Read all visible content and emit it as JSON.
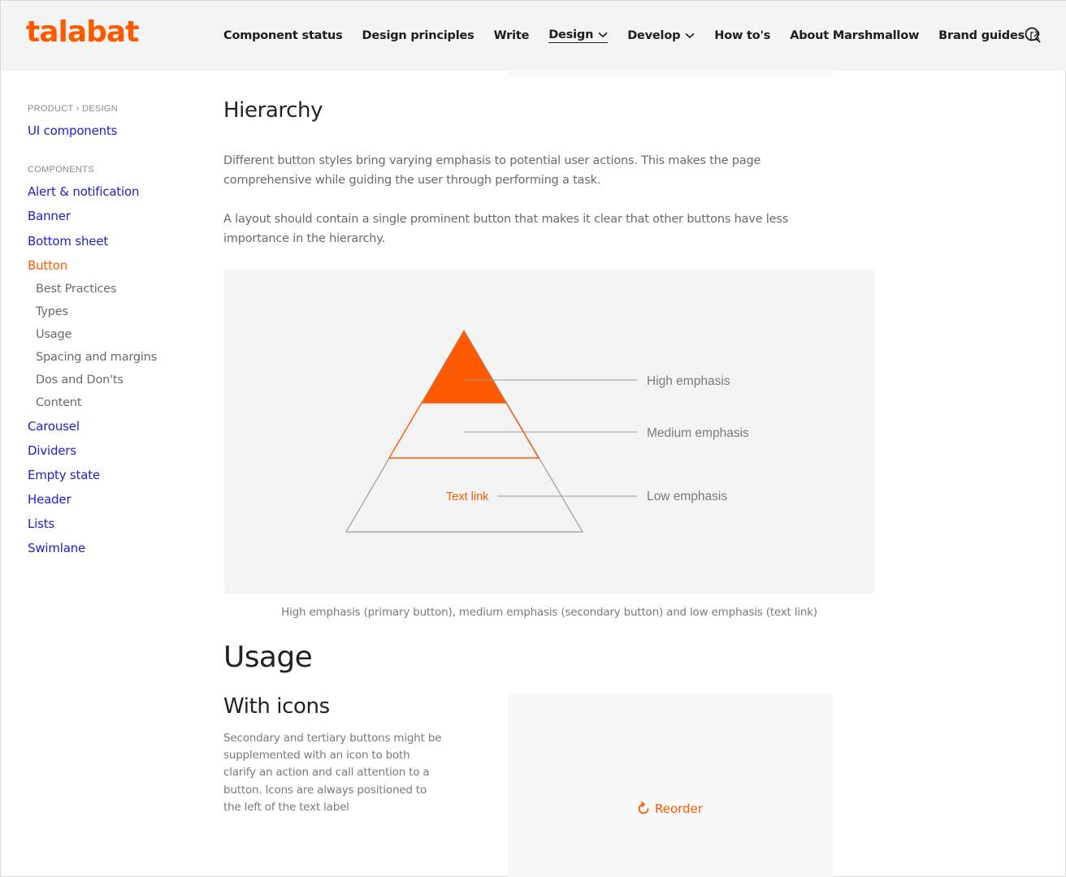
{
  "brand": {
    "logo": "talabat",
    "accent": "#ff5a00",
    "link": "#1f1fcc"
  },
  "nav": [
    {
      "label": "Component status"
    },
    {
      "label": "Design principles"
    },
    {
      "label": "Write"
    },
    {
      "label": "Design",
      "dropdown": true,
      "active": true
    },
    {
      "label": "Develop",
      "dropdown": true
    },
    {
      "label": "How to's"
    },
    {
      "label": "About Marshmallow"
    },
    {
      "label": "Brand guides",
      "external": true
    }
  ],
  "sidebar": {
    "breadcrumb": "PRODUCT › DESIGN",
    "section_link": "UI components",
    "components_label": "COMPONENTS",
    "items": [
      {
        "label": "Alert & notification"
      },
      {
        "label": "Banner"
      },
      {
        "label": "Bottom sheet"
      },
      {
        "label": "Button",
        "active": true,
        "sub": [
          "Best Practices",
          "Types",
          "Usage",
          "Spacing and margins",
          "Dos and Don'ts",
          "Content"
        ]
      },
      {
        "label": "Carousel"
      },
      {
        "label": "Dividers"
      },
      {
        "label": "Empty state"
      },
      {
        "label": "Header"
      },
      {
        "label": "Lists"
      },
      {
        "label": "Swimlane"
      }
    ]
  },
  "content": {
    "hierarchy_title": "Hierarchy",
    "para1": "Different button styles bring varying emphasis to potential user actions. This makes the page comprehensive while guiding the user through performing a task.",
    "para2": "A layout should contain a single prominent button that makes it clear that other buttons have less importance in the hierarchy.",
    "pyramid": {
      "high": "High emphasis",
      "medium": "Medium emphasis",
      "low": "Low emphasis",
      "text_link": "Text link"
    },
    "caption": "High emphasis (primary button), medium emphasis (secondary button) and low emphasis (text link)",
    "usage_title": "Usage",
    "with_icons_title": "With icons",
    "with_icons_text": "Secondary and tertiary buttons might be supplemented with an icon to both clarify an action and call attention to a button. Icons are always positioned to the left of the text label",
    "reorder_label": "Reorder"
  }
}
